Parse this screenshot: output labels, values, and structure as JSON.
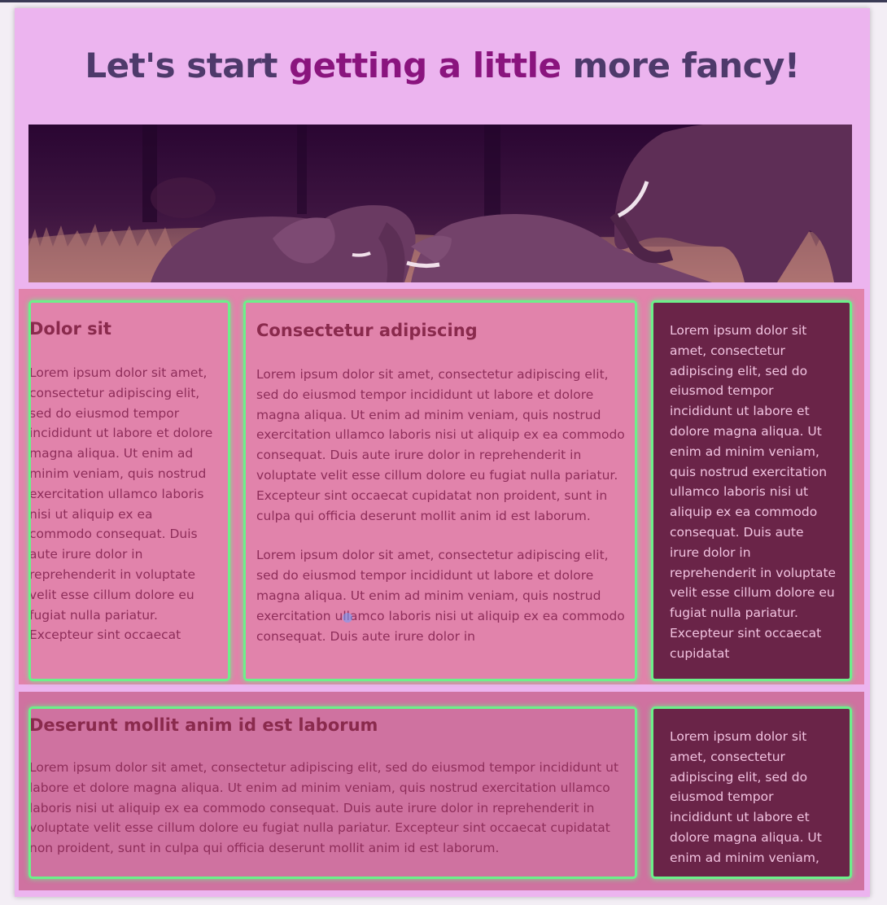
{
  "header": {
    "title_part1": "Let's start ",
    "title_accent": "getting a little",
    "title_part2": " more fancy!"
  },
  "hero": {
    "subject": "elephants-photo"
  },
  "row1": {
    "col1": {
      "heading": "Dolor sit",
      "text": "Lorem ipsum dolor sit amet, consectetur adipiscing elit, sed do eiusmod tempor incididunt ut labore et dolore magna aliqua. Ut enim ad minim veniam, quis nostrud exercitation ullamco laboris nisi ut aliquip ex ea commodo consequat. Duis aute irure dolor in reprehenderit in voluptate velit esse cillum dolore eu fugiat nulla pariatur. Excepteur sint occaecat"
    },
    "col2": {
      "heading": "Consectetur adipiscing",
      "para1": "Lorem ipsum dolor sit amet, consectetur adipiscing elit, sed do eiusmod tempor incididunt ut labore et dolore magna aliqua. Ut enim ad minim veniam, quis nostrud exercitation ullamco laboris nisi ut aliquip ex ea commodo consequat. Duis aute irure dolor in reprehenderit in voluptate velit esse cillum dolore eu fugiat nulla pariatur. Excepteur sint occaecat cupidatat non proident, sunt in culpa qui officia deserunt mollit anim id est laborum.",
      "para2": "Lorem ipsum dolor sit amet, consectetur adipiscing elit, sed do eiusmod tempor incididunt ut labore et dolore magna aliqua. Ut enim ad minim veniam, quis nostrud exercitation ullamco laboris nisi ut aliquip ex ea commodo consequat. Duis aute irure dolor in"
    },
    "col3": {
      "text": "Lorem ipsum dolor sit amet, consectetur adipiscing elit, sed do eiusmod tempor incididunt ut labore et dolore magna aliqua. Ut enim ad minim veniam, quis nostrud exercitation ullamco laboris nisi ut aliquip ex ea commodo consequat. Duis aute irure dolor in reprehenderit in voluptate velit esse cillum dolore eu fugiat nulla pariatur. Excepteur sint occaecat cupidatat"
    }
  },
  "row2": {
    "col1": {
      "heading": "Deserunt mollit anim id est laborum",
      "text": "Lorem ipsum dolor sit amet, consectetur adipiscing elit, sed do eiusmod tempor incididunt ut labore et dolore magna aliqua. Ut enim ad minim veniam, quis nostrud exercitation ullamco laboris nisi ut aliquip ex ea commodo consequat. Duis aute irure dolor in reprehenderit in voluptate velit esse cillum dolore eu fugiat nulla pariatur. Excepteur sint occaecat cupidatat non proident, sunt in culpa qui officia deserunt mollit anim id est laborum."
    },
    "col2": {
      "text": "Lorem ipsum dolor sit amet, consectetur adipiscing elit, sed do eiusmod tempor incididunt ut labore et dolore magna aliqua. Ut enim ad minim veniam,"
    }
  },
  "colors": {
    "page_bg": "#ecb4ef",
    "title": "#4e3a6b",
    "title_accent": "#8a147e",
    "row_bg": "#e183ab",
    "column_outline": "#6cf08a",
    "dark_column": "#6a2448"
  }
}
